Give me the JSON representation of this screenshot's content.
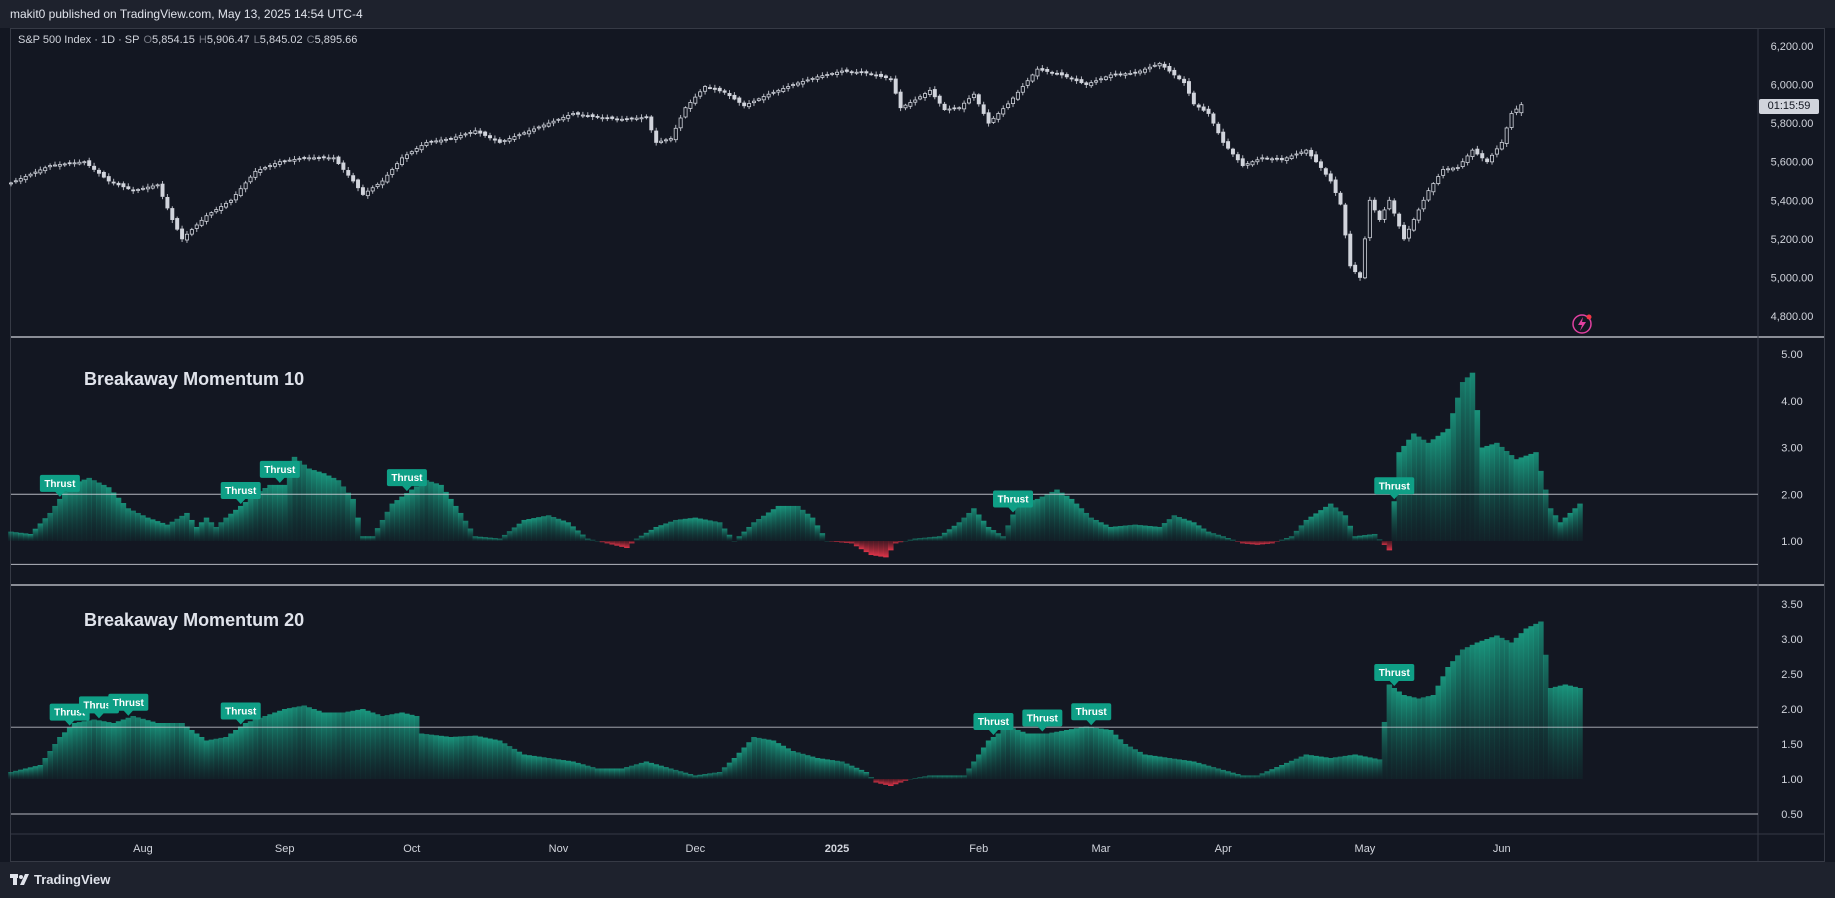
{
  "header": {
    "publish_text": "makit0 published on TradingView.com, May 13, 2025 14:54 UTC-4"
  },
  "footer": {
    "logo_text": "TradingView"
  },
  "legend": {
    "symbol": "S&P 500 Index · 1D · SP",
    "open_label": "O",
    "open": "5,854.15",
    "high_label": "H",
    "high": "5,906.47",
    "low_label": "L",
    "low": "5,845.02",
    "close_label": "C",
    "close": "5,895.66"
  },
  "timer": "01:15:59",
  "colors": {
    "background": "#131722",
    "up": "#131722",
    "down": "#d1d4dc",
    "wick": "#b2b5be",
    "positive": "#1a9c82",
    "negative": "#e0354a",
    "thrust": "#0f9f86",
    "line": "#d1d4dc"
  },
  "chart_data": [
    {
      "type": "candlestick",
      "title": "S&P 500 Index · 1D · SP",
      "ylim": [
        4700,
        6300
      ],
      "yticks": [
        "6,200.00",
        "6,000.00",
        "5,800.00",
        "5,600.00",
        "5,400.00",
        "5,200.00",
        "5,000.00",
        "4,800.00"
      ],
      "ytick_values": [
        6200,
        6000,
        5800,
        5600,
        5400,
        5200,
        5000,
        4800
      ],
      "xticks": [
        "Aug",
        "Sep",
        "Oct",
        "Nov",
        "Dec",
        "2025",
        "Feb",
        "Mar",
        "Apr",
        "May",
        "Jun"
      ],
      "anchors": [
        [
          0,
          5490
        ],
        [
          8,
          5580
        ],
        [
          15,
          5600
        ],
        [
          20,
          5500
        ],
        [
          25,
          5450
        ],
        [
          30,
          5480
        ],
        [
          33,
          5300
        ],
        [
          35,
          5200
        ],
        [
          40,
          5320
        ],
        [
          45,
          5400
        ],
        [
          50,
          5550
        ],
        [
          55,
          5600
        ],
        [
          60,
          5620
        ],
        [
          66,
          5620
        ],
        [
          70,
          5500
        ],
        [
          72,
          5430
        ],
        [
          76,
          5500
        ],
        [
          80,
          5620
        ],
        [
          85,
          5700
        ],
        [
          90,
          5720
        ],
        [
          95,
          5760
        ],
        [
          100,
          5700
        ],
        [
          105,
          5750
        ],
        [
          110,
          5800
        ],
        [
          115,
          5850
        ],
        [
          120,
          5830
        ],
        [
          125,
          5820
        ],
        [
          130,
          5830
        ],
        [
          132,
          5700
        ],
        [
          135,
          5720
        ],
        [
          138,
          5880
        ],
        [
          142,
          5990
        ],
        [
          146,
          5960
        ],
        [
          150,
          5890
        ],
        [
          155,
          5950
        ],
        [
          160,
          6000
        ],
        [
          165,
          6040
        ],
        [
          170,
          6070
        ],
        [
          175,
          6060
        ],
        [
          180,
          6030
        ],
        [
          182,
          5880
        ],
        [
          185,
          5920
        ],
        [
          188,
          5970
        ],
        [
          191,
          5870
        ],
        [
          194,
          5880
        ],
        [
          197,
          5950
        ],
        [
          200,
          5800
        ],
        [
          204,
          5900
        ],
        [
          210,
          6080
        ],
        [
          215,
          6050
        ],
        [
          220,
          6000
        ],
        [
          225,
          6050
        ],
        [
          230,
          6060
        ],
        [
          235,
          6110
        ],
        [
          240,
          6010
        ],
        [
          242,
          5900
        ],
        [
          245,
          5850
        ],
        [
          248,
          5700
        ],
        [
          252,
          5580
        ],
        [
          256,
          5620
        ],
        [
          260,
          5610
        ],
        [
          265,
          5660
        ],
        [
          268,
          5570
        ],
        [
          270,
          5500
        ],
        [
          272,
          5380
        ],
        [
          274,
          5060
        ],
        [
          276,
          5000
        ],
        [
          278,
          5400
        ],
        [
          280,
          5300
        ],
        [
          282,
          5400
        ],
        [
          285,
          5200
        ],
        [
          288,
          5350
        ],
        [
          290,
          5450
        ],
        [
          293,
          5560
        ],
        [
          296,
          5570
        ],
        [
          299,
          5660
        ],
        [
          302,
          5600
        ],
        [
          305,
          5700
        ],
        [
          307,
          5850
        ],
        [
          309,
          5895.66
        ]
      ],
      "ohlc_last": {
        "open": 5854.15,
        "high": 5906.47,
        "low": 5845.02,
        "close": 5895.66
      }
    },
    {
      "type": "area",
      "title": "Breakaway Momentum 10",
      "ylim": [
        0.45,
        5.3
      ],
      "yticks": [
        "5.00",
        "4.00",
        "3.00",
        "2.00",
        "1.00"
      ],
      "ytick_values": [
        5,
        4,
        3,
        2,
        1
      ],
      "hlines": [
        2.0,
        0.5
      ],
      "baseline": 1.0,
      "anchors": [
        [
          0,
          1.2
        ],
        [
          4,
          1.15
        ],
        [
          8,
          1.6
        ],
        [
          12,
          2.2
        ],
        [
          16,
          2.35
        ],
        [
          20,
          2.15
        ],
        [
          24,
          1.7
        ],
        [
          28,
          1.5
        ],
        [
          32,
          1.35
        ],
        [
          36,
          1.6
        ],
        [
          38,
          1.3
        ],
        [
          40,
          1.5
        ],
        [
          42,
          1.3
        ],
        [
          44,
          1.5
        ],
        [
          47,
          1.75
        ],
        [
          50,
          2.0
        ],
        [
          53,
          2.2
        ],
        [
          56,
          2.2
        ],
        [
          58,
          2.8
        ],
        [
          61,
          2.55
        ],
        [
          64,
          2.45
        ],
        [
          67,
          2.3
        ],
        [
          70,
          1.9
        ],
        [
          72,
          1.1
        ],
        [
          74,
          1.1
        ],
        [
          78,
          1.8
        ],
        [
          82,
          2.1
        ],
        [
          85,
          2.3
        ],
        [
          88,
          2.2
        ],
        [
          92,
          1.6
        ],
        [
          95,
          1.1
        ],
        [
          100,
          1.05
        ],
        [
          105,
          1.45
        ],
        [
          110,
          1.55
        ],
        [
          114,
          1.4
        ],
        [
          118,
          1.05
        ],
        [
          122,
          0.95
        ],
        [
          126,
          0.85
        ],
        [
          128,
          1.05
        ],
        [
          132,
          1.3
        ],
        [
          136,
          1.45
        ],
        [
          140,
          1.5
        ],
        [
          145,
          1.4
        ],
        [
          148,
          1.0
        ],
        [
          152,
          1.4
        ],
        [
          157,
          1.75
        ],
        [
          161,
          1.75
        ],
        [
          164,
          1.5
        ],
        [
          167,
          1.0
        ],
        [
          172,
          0.95
        ],
        [
          176,
          0.7
        ],
        [
          179,
          0.65
        ],
        [
          181,
          0.95
        ],
        [
          185,
          1.05
        ],
        [
          190,
          1.1
        ],
        [
          194,
          1.4
        ],
        [
          197,
          1.7
        ],
        [
          200,
          1.3
        ],
        [
          203,
          1.1
        ],
        [
          206,
          1.8
        ],
        [
          210,
          1.9
        ],
        [
          214,
          2.1
        ],
        [
          217,
          1.9
        ],
        [
          221,
          1.5
        ],
        [
          225,
          1.3
        ],
        [
          230,
          1.35
        ],
        [
          235,
          1.3
        ],
        [
          238,
          1.55
        ],
        [
          242,
          1.4
        ],
        [
          245,
          1.2
        ],
        [
          248,
          1.1
        ],
        [
          252,
          0.95
        ],
        [
          255,
          0.92
        ],
        [
          258,
          0.95
        ],
        [
          262,
          1.1
        ],
        [
          265,
          1.45
        ],
        [
          270,
          1.8
        ],
        [
          273,
          1.55
        ],
        [
          275,
          1.1
        ],
        [
          279,
          1.15
        ],
        [
          282,
          0.8
        ],
        [
          284,
          2.9
        ],
        [
          287,
          3.3
        ],
        [
          290,
          3.1
        ],
        [
          294,
          3.4
        ],
        [
          297,
          4.4
        ],
        [
          299,
          4.6
        ],
        [
          301,
          3.0
        ],
        [
          304,
          3.1
        ],
        [
          308,
          2.75
        ],
        [
          312,
          2.9
        ],
        [
          315,
          1.7
        ],
        [
          317,
          1.4
        ],
        [
          321,
          1.8
        ]
      ],
      "thrust_labels": [
        {
          "i": 10,
          "text": "Thrust"
        },
        {
          "i": 47,
          "text": "Thrust"
        },
        {
          "i": 55,
          "text": "Thrust"
        },
        {
          "i": 81,
          "text": "Thrust"
        },
        {
          "i": 205,
          "text": "Thrust"
        },
        {
          "i": 283,
          "text": "Thrust"
        }
      ]
    },
    {
      "type": "area",
      "title": "Breakaway Momentum 20",
      "ylim": [
        0.35,
        3.65
      ],
      "yticks": [
        "3.50",
        "3.00",
        "2.50",
        "2.00",
        "1.50",
        "1.00",
        "0.50"
      ],
      "ytick_values": [
        3.5,
        3.0,
        2.5,
        2.0,
        1.5,
        1.0,
        0.5
      ],
      "hlines": [
        1.74,
        0.5
      ],
      "baseline": 1.0,
      "anchors": [
        [
          0,
          1.1
        ],
        [
          6,
          1.2
        ],
        [
          10,
          1.6
        ],
        [
          13,
          1.8
        ],
        [
          17,
          1.85
        ],
        [
          21,
          1.8
        ],
        [
          25,
          1.9
        ],
        [
          30,
          1.8
        ],
        [
          35,
          1.8
        ],
        [
          40,
          1.55
        ],
        [
          44,
          1.6
        ],
        [
          48,
          1.8
        ],
        [
          52,
          1.9
        ],
        [
          56,
          2.0
        ],
        [
          60,
          2.05
        ],
        [
          64,
          1.95
        ],
        [
          68,
          1.95
        ],
        [
          72,
          2.0
        ],
        [
          76,
          1.9
        ],
        [
          80,
          1.95
        ],
        [
          83,
          1.9
        ],
        [
          84,
          1.65
        ],
        [
          90,
          1.6
        ],
        [
          95,
          1.62
        ],
        [
          100,
          1.55
        ],
        [
          105,
          1.35
        ],
        [
          110,
          1.3
        ],
        [
          115,
          1.25
        ],
        [
          120,
          1.15
        ],
        [
          125,
          1.15
        ],
        [
          130,
          1.25
        ],
        [
          135,
          1.15
        ],
        [
          140,
          1.05
        ],
        [
          145,
          1.1
        ],
        [
          148,
          1.3
        ],
        [
          152,
          1.6
        ],
        [
          156,
          1.55
        ],
        [
          160,
          1.4
        ],
        [
          165,
          1.3
        ],
        [
          170,
          1.25
        ],
        [
          175,
          1.1
        ],
        [
          177,
          0.95
        ],
        [
          180,
          0.9
        ],
        [
          184,
          1.0
        ],
        [
          188,
          1.05
        ],
        [
          195,
          1.05
        ],
        [
          200,
          1.55
        ],
        [
          204,
          1.75
        ],
        [
          208,
          1.65
        ],
        [
          212,
          1.65
        ],
        [
          216,
          1.7
        ],
        [
          220,
          1.75
        ],
        [
          225,
          1.7
        ],
        [
          228,
          1.5
        ],
        [
          232,
          1.35
        ],
        [
          237,
          1.3
        ],
        [
          242,
          1.25
        ],
        [
          247,
          1.15
        ],
        [
          252,
          1.05
        ],
        [
          255,
          1.05
        ],
        [
          260,
          1.2
        ],
        [
          265,
          1.35
        ],
        [
          270,
          1.3
        ],
        [
          275,
          1.35
        ],
        [
          280,
          1.28
        ],
        [
          282,
          2.35
        ],
        [
          285,
          2.2
        ],
        [
          288,
          2.15
        ],
        [
          291,
          2.2
        ],
        [
          294,
          2.6
        ],
        [
          297,
          2.85
        ],
        [
          300,
          2.95
        ],
        [
          304,
          3.05
        ],
        [
          307,
          2.95
        ],
        [
          310,
          3.15
        ],
        [
          313,
          3.25
        ],
        [
          315,
          2.3
        ],
        [
          318,
          2.35
        ],
        [
          321,
          2.3
        ]
      ],
      "thrust_labels": [
        {
          "i": 12,
          "text": "Thrust"
        },
        {
          "i": 18,
          "text": "Thrust"
        },
        {
          "i": 24,
          "text": "Thrust"
        },
        {
          "i": 47,
          "text": "Thrust"
        },
        {
          "i": 201,
          "text": "Thrust"
        },
        {
          "i": 211,
          "text": "Thrust"
        },
        {
          "i": 221,
          "text": "Thrust"
        },
        {
          "i": 283,
          "text": "Thrust"
        }
      ]
    }
  ]
}
